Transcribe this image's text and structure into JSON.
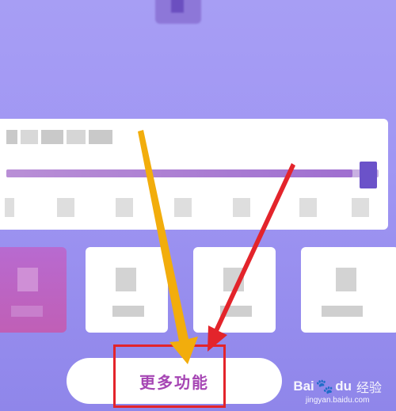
{
  "button": {
    "more_features": "更多功能"
  },
  "watermark": {
    "brand_a": "Bai",
    "brand_b": "du",
    "brand_cn": "经验",
    "url": "jingyan.baidu.com"
  },
  "info_card": {
    "progress_fraction": 0.93
  },
  "annotation": {
    "highlight_color": "#e3242b",
    "yellow_arrow_color": "#f2ad0c",
    "red_arrow_color": "#e3242b"
  }
}
